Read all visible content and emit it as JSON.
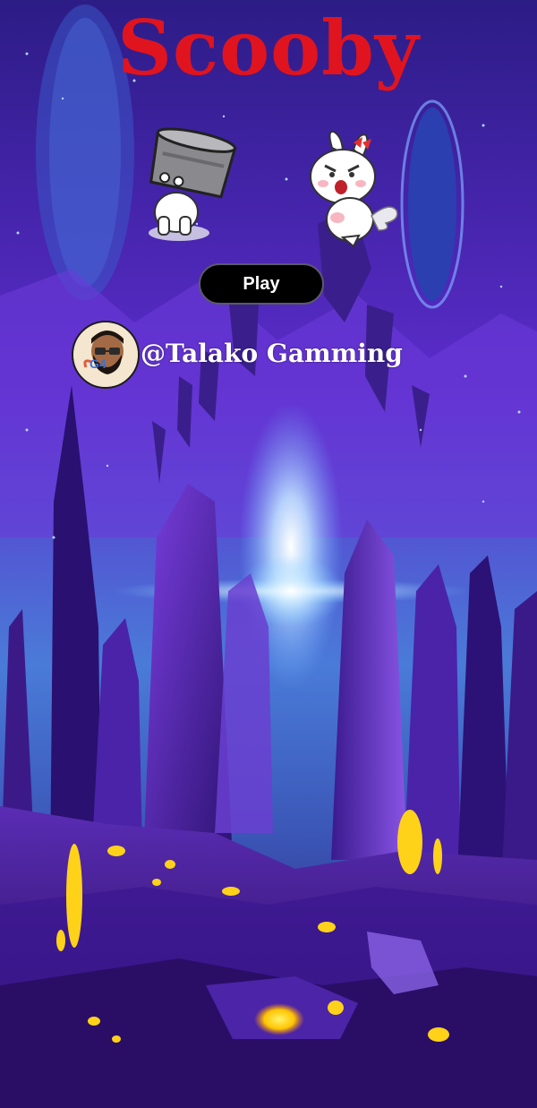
{
  "game": {
    "title": "Scooby",
    "play_label": "Play",
    "credit": "@Talako Gamming",
    "avatar_badge": "G4"
  },
  "colors": {
    "title": "#e0141e",
    "play_bg": "#000000",
    "play_text": "#ffffff",
    "sky_top": "#2e1e8e",
    "sky_mid": "#6a2fd6",
    "horizon_glow": "#c8e4ff",
    "lava": "#ffd21a"
  },
  "icons": {
    "left_character": "bunny-hiding-under-pot-icon",
    "right_character": "angry-bunny-icon",
    "avatar": "bearded-gamer-avatar-icon"
  }
}
